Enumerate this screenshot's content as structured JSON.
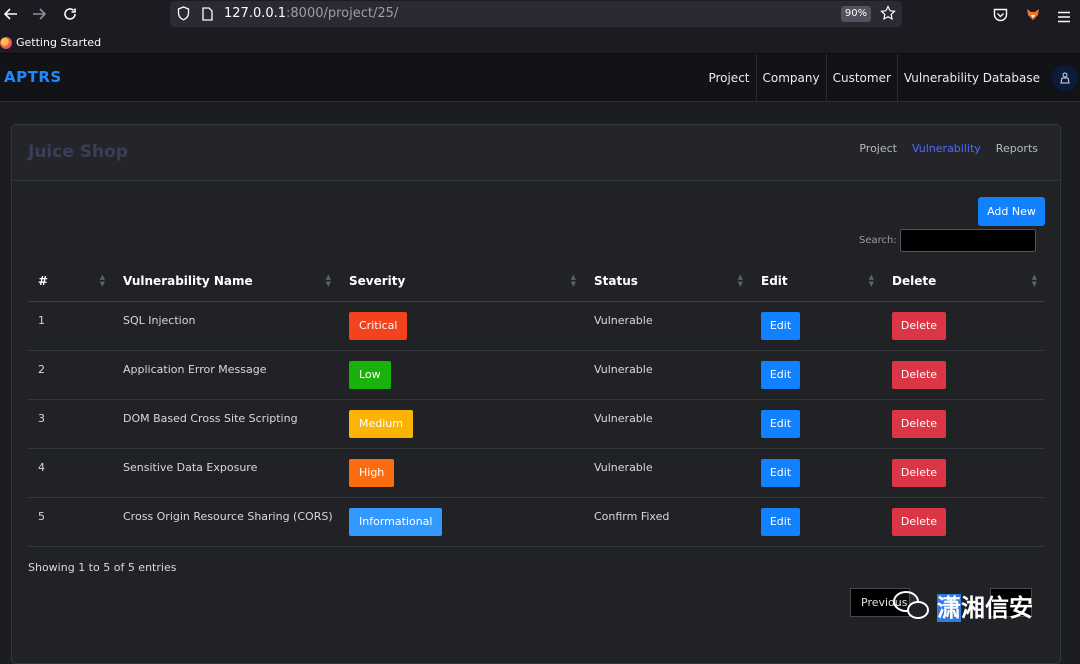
{
  "browser": {
    "url_host": "127.0.0.1",
    "url_rest": ":8000/project/25/",
    "zoom": "90%",
    "bookmark": "Getting Started"
  },
  "navbar": {
    "brand": "APTRS",
    "links": [
      "Project",
      "Company",
      "Customer",
      "Vulnerability Database"
    ]
  },
  "card": {
    "title": "Juice Shop",
    "tabs": [
      "Project",
      "Vulnerability",
      "Reports"
    ],
    "active_tab": "Vulnerability",
    "add_new_label": "Add New",
    "search_label": "Search:"
  },
  "table": {
    "columns": [
      "#",
      "Vulnerability Name",
      "Severity",
      "Status",
      "Edit",
      "Delete"
    ],
    "rows": [
      {
        "id": "1",
        "name": "SQL Injection",
        "severity": "Critical",
        "severity_color": "#f4411e",
        "status": "Vulnerable",
        "edit": "Edit",
        "delete": "Delete"
      },
      {
        "id": "2",
        "name": "Application Error Message",
        "severity": "Low",
        "severity_color": "#19b20a",
        "status": "Vulnerable",
        "edit": "Edit",
        "delete": "Delete"
      },
      {
        "id": "3",
        "name": "DOM Based Cross Site Scripting",
        "severity": "Medium",
        "severity_color": "#fbb406",
        "status": "Vulnerable",
        "edit": "Edit",
        "delete": "Delete"
      },
      {
        "id": "4",
        "name": "Sensitive Data Exposure",
        "severity": "High",
        "severity_color": "#fb6b0f",
        "status": "Vulnerable",
        "edit": "Edit",
        "delete": "Delete"
      },
      {
        "id": "5",
        "name": "Cross Origin Resource Sharing (CORS)",
        "severity": "Informational",
        "severity_color": "#3299ff",
        "status": "Confirm Fixed",
        "edit": "Edit",
        "delete": "Delete"
      }
    ]
  },
  "footer": {
    "entries_info": "Showing 1 to 5 of 5 entries",
    "prev_label": "Previous"
  },
  "watermark": {
    "text_highlight": "潇",
    "text_rest": "湘信安"
  },
  "colors": {
    "accent": "#1281ff",
    "danger": "#dc3545",
    "brand": "#1d8bff"
  }
}
